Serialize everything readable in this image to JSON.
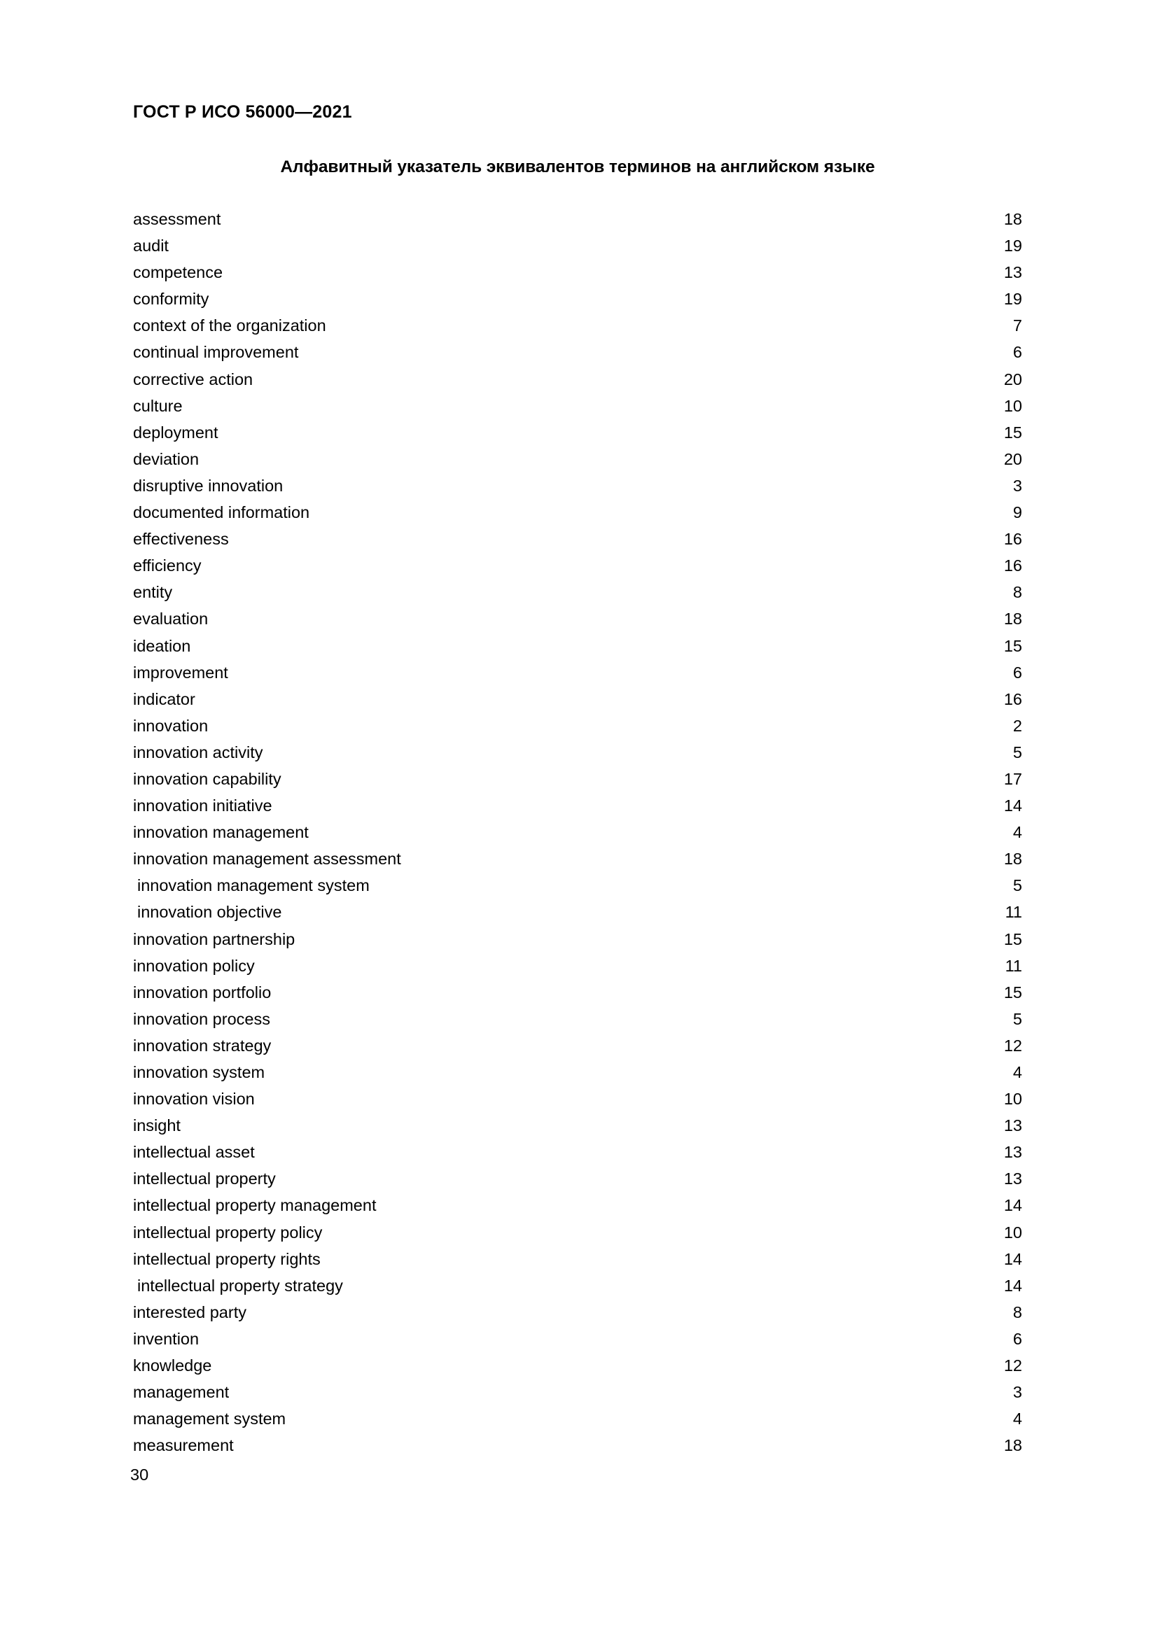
{
  "document": {
    "header": "ГОСТ Р ИСО 56000—2021",
    "title": "Алфавитный указатель эквивалентов терминов на английском языке",
    "footer_page_number": "30"
  },
  "index": {
    "entries": [
      {
        "term": "assessment",
        "page": "18",
        "indented": false
      },
      {
        "term": "audit",
        "page": "19",
        "indented": false
      },
      {
        "term": "competence",
        "page": "13",
        "indented": false
      },
      {
        "term": "conformity",
        "page": "19",
        "indented": false
      },
      {
        "term": "context of the organization",
        "page": "7",
        "indented": false
      },
      {
        "term": "continual improvement",
        "page": "6",
        "indented": false
      },
      {
        "term": "corrective action",
        "page": "20",
        "indented": false
      },
      {
        "term": "culture",
        "page": "10",
        "indented": false
      },
      {
        "term": "deployment",
        "page": "15",
        "indented": false
      },
      {
        "term": "deviation",
        "page": "20",
        "indented": false
      },
      {
        "term": "disruptive innovation",
        "page": "3",
        "indented": false
      },
      {
        "term": "documented information",
        "page": "9",
        "indented": false
      },
      {
        "term": "effectiveness",
        "page": "16",
        "indented": false
      },
      {
        "term": "efficiency",
        "page": "16",
        "indented": false
      },
      {
        "term": "entity",
        "page": "8",
        "indented": false
      },
      {
        "term": "evaluation",
        "page": "18",
        "indented": false
      },
      {
        "term": "ideation",
        "page": "15",
        "indented": false
      },
      {
        "term": "improvement",
        "page": "6",
        "indented": false
      },
      {
        "term": "indicator",
        "page": "16",
        "indented": false
      },
      {
        "term": "innovation",
        "page": "2",
        "indented": false
      },
      {
        "term": "innovation activity",
        "page": "5",
        "indented": false
      },
      {
        "term": "innovation capability",
        "page": "17",
        "indented": false
      },
      {
        "term": "innovation initiative",
        "page": "14",
        "indented": false
      },
      {
        "term": "innovation management",
        "page": "4",
        "indented": false
      },
      {
        "term": "innovation management assessment",
        "page": "18",
        "indented": false
      },
      {
        "term": "innovation management system",
        "page": "5",
        "indented": true
      },
      {
        "term": "innovation objective",
        "page": "11",
        "indented": true
      },
      {
        "term": "innovation partnership",
        "page": "15",
        "indented": false
      },
      {
        "term": "innovation policy",
        "page": "11",
        "indented": false
      },
      {
        "term": "innovation portfolio",
        "page": "15",
        "indented": false
      },
      {
        "term": "innovation process",
        "page": "5",
        "indented": false
      },
      {
        "term": "innovation strategy",
        "page": "12",
        "indented": false
      },
      {
        "term": "innovation system",
        "page": "4",
        "indented": false
      },
      {
        "term": "innovation vision",
        "page": "10",
        "indented": false
      },
      {
        "term": "insight",
        "page": "13",
        "indented": false
      },
      {
        "term": "intellectual asset",
        "page": "13",
        "indented": false
      },
      {
        "term": "intellectual property",
        "page": "13",
        "indented": false
      },
      {
        "term": "intellectual property management",
        "page": "14",
        "indented": false
      },
      {
        "term": "intellectual property policy",
        "page": "10",
        "indented": false
      },
      {
        "term": "intellectual property rights",
        "page": "14",
        "indented": false
      },
      {
        "term": "intellectual property strategy",
        "page": "14",
        "indented": true
      },
      {
        "term": "interested party",
        "page": "8",
        "indented": false
      },
      {
        "term": "invention",
        "page": "6",
        "indented": false
      },
      {
        "term": "knowledge",
        "page": "12",
        "indented": false
      },
      {
        "term": "management",
        "page": "3",
        "indented": false
      },
      {
        "term": "management system",
        "page": "4",
        "indented": false
      },
      {
        "term": "measurement",
        "page": "18",
        "indented": false
      }
    ]
  }
}
